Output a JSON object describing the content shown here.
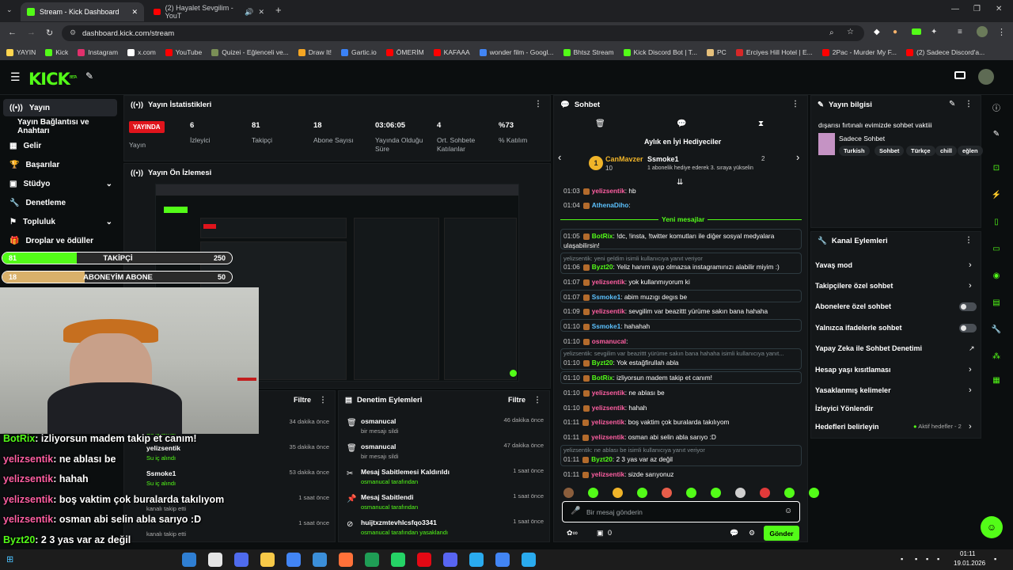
{
  "browser": {
    "tabs": [
      {
        "label": "Stream - Kick Dashboard"
      },
      {
        "label": "(2) Hayalet Sevgilim - YouT"
      }
    ],
    "url": "dashboard.kick.com/stream",
    "bookmarks": [
      "YAYIN",
      "Kick",
      "Instagram",
      "x.com",
      "YouTube",
      "Quizei - Eğlenceli ve...",
      "Draw It!",
      "Gartic.io",
      "ÖMERİM",
      "KAFAAA",
      "wonder film - Googl...",
      "Bhtsz Stream",
      "Kick Discord Bot | T...",
      "PC",
      "Erciyes Hill Hotel | E...",
      "2Pac - Murder My F...",
      "(2) Sadece Discord'a..."
    ]
  },
  "header": {
    "logo": "KICK",
    "beta": "BETA"
  },
  "sidebar": {
    "items": [
      {
        "label": "Yayın"
      },
      {
        "label": "Yayın Bağlantısı ve Anahtarı"
      },
      {
        "label": "Gelir"
      },
      {
        "label": "Başarılar"
      },
      {
        "label": "Stüdyo"
      },
      {
        "label": "Denetleme"
      },
      {
        "label": "Topluluk"
      },
      {
        "label": "Droplar ve ödüller"
      }
    ]
  },
  "stats": {
    "title": "Yayın İstatistikleri",
    "status": "YAYINDA",
    "status_label": "Yayın",
    "items": [
      {
        "value": "6",
        "label": "İzleyici"
      },
      {
        "value": "81",
        "label": "Takipçi"
      },
      {
        "value": "18",
        "label": "Abone Sayısı"
      },
      {
        "value": "03:06:05",
        "label": "Yayında Olduğu Süre"
      },
      {
        "value": "4",
        "label": "Ort. Sohbete Katılanlar"
      },
      {
        "value": "%73",
        "label": "% Katılım"
      }
    ]
  },
  "preview": {
    "title": "Yayın Ön İzlemesi"
  },
  "overlay": {
    "goals": [
      {
        "left": "81",
        "center": "TAKİPÇİ",
        "right": "250",
        "fill": 0.324
      },
      {
        "left": "18",
        "center": "ABONEYİM ABONE",
        "right": "50",
        "fill": 0.36
      }
    ],
    "chat": [
      {
        "user": "BotRix",
        "text": ": izliyorsun madem takip et canım!",
        "color": "#53fc18"
      },
      {
        "user": "yelizsentik",
        "text": ": ne ablası be",
        "color": "#ff5fa2"
      },
      {
        "user": "yelizsentik",
        "text": ": hahah",
        "color": "#ff5fa2"
      },
      {
        "user": "yelizsentik",
        "text": ": boş vaktim çok buralarda takılıyom",
        "color": "#ff5fa2"
      },
      {
        "user": "yelizsentik",
        "text": ": osman abi selin abla sarıyo :D",
        "color": "#ff5fa2"
      },
      {
        "user": "Byzt20",
        "text": ": 2 3 yas var az değil",
        "color": "#53fc18"
      },
      {
        "user": "yelizsentik",
        "text": ": sizde sarıyonuz",
        "color": "#ff5fa2"
      }
    ]
  },
  "activity": {
    "filter": "Filtre",
    "items": [
      {
        "title": "yelizsentik",
        "sub": "Su iç alındı",
        "time": "34 dakika önce"
      },
      {
        "title": "yelizsentik",
        "sub": "Su iç alındı",
        "time": "35 dakika önce"
      },
      {
        "title": "Ssmoke1",
        "sub": "Su iç alındı",
        "time": "53 dakika önce"
      },
      {
        "title": "",
        "sub": "kanalı takip etti",
        "time": "1 saat önce"
      },
      {
        "title": "",
        "sub": "kanalı takip etti",
        "time": "1 saat önce"
      }
    ]
  },
  "moderation": {
    "title": "Denetim Eylemleri",
    "filter": "Filtre",
    "items": [
      {
        "title": "osmanucal",
        "sub": "bir mesajı sildi",
        "time": "46 dakika önce",
        "icon": "trash-icon"
      },
      {
        "title": "osmanucal",
        "sub": "bir mesajı sildi",
        "time": "47 dakika önce",
        "icon": "trash-icon"
      },
      {
        "title": "Mesaj Sabitlemesi Kaldırıldı",
        "sub": "osmanucal tarafından",
        "time": "1 saat önce",
        "icon": "unpin-icon"
      },
      {
        "title": "Mesaj Sabitlendi",
        "sub": "osmanucal tarafından",
        "time": "1 saat önce",
        "icon": "pin-icon"
      },
      {
        "title": "huijtxzmtevhlcsfqo3341",
        "sub": "osmanucal tarafından yasaklandı",
        "time": "1 saat önce",
        "icon": "ban-icon"
      }
    ]
  },
  "chat": {
    "title": "Sohbet",
    "top_gifters": "Aylık en İyi Hediyeciler",
    "gifter1": {
      "name": "CanMavzer",
      "count": "10"
    },
    "gifter2": {
      "name": "Ssmoke1",
      "count": "2",
      "note": "1 abonelik hediye ederek 3. sıraya yükselin"
    },
    "new_messages": "Yeni mesajlar",
    "messages": [
      {
        "time": "01:03",
        "user": "yelizsentik",
        "text": ": hb",
        "color": "#ff5fa2"
      },
      {
        "time": "01:04",
        "user": "AthenaDiho",
        "text": ":",
        "color": "#5cc2ff"
      },
      {
        "time": "01:05",
        "user": "BotRix",
        "text": ": !dc, !insta, !twitter komutları ile diğer sosyal medyalara ulaşabilirsin!",
        "color": "#53fc18"
      },
      {
        "time": "01:06",
        "user": "Byzt20",
        "text": ": Yeliz hanım ayıp olmazsa instagramınızı alabilir miyim :)",
        "color": "#53fc18"
      },
      {
        "time": "01:07",
        "user": "yelizsentik",
        "text": ": yok kullanmıyorum ki",
        "color": "#ff5fa2"
      },
      {
        "time": "01:07",
        "user": "Ssmoke1",
        "text": ": abim muzıgı degıs be",
        "color": "#5cc2ff"
      },
      {
        "time": "01:09",
        "user": "yelizsentik",
        "text": ": sevgilim var beazittt yürüme sakın bana hahaha",
        "color": "#ff5fa2"
      },
      {
        "time": "01:10",
        "user": "Ssmoke1",
        "text": ": hahahah",
        "color": "#5cc2ff"
      },
      {
        "time": "01:10",
        "user": "osmanucal",
        "text": ":",
        "color": "#ff5fa2"
      },
      {
        "time": "01:10",
        "user": "Byzt20",
        "text": ": Yok estağfirullah abla",
        "color": "#53fc18"
      },
      {
        "time": "01:10",
        "user": "BotRix",
        "text": ": izliyorsun madem takip et canım!",
        "color": "#53fc18"
      },
      {
        "time": "01:10",
        "user": "yelizsentik",
        "text": ": ne ablası be",
        "color": "#ff5fa2"
      },
      {
        "time": "01:10",
        "user": "yelizsentik",
        "text": ": hahah",
        "color": "#ff5fa2"
      },
      {
        "time": "01:11",
        "user": "yelizsentik",
        "text": ": boş vaktim çok buralarda takılıyom",
        "color": "#ff5fa2"
      },
      {
        "time": "01:11",
        "user": "yelizsentik",
        "text": ": osman abi selin abla sarıyo :D",
        "color": "#ff5fa2"
      },
      {
        "time": "01:11",
        "user": "Byzt20",
        "text": ": 2 3 yas var az değil",
        "color": "#53fc18"
      },
      {
        "time": "01:11",
        "user": "yelizsentik",
        "text": ": sizde sarıyonuz",
        "color": "#ff5fa2"
      }
    ],
    "replies": [
      "yelizsentik: yeni geldim isimli kullanıcıya yanıt veriyor",
      "yelizsentik: sevgilim var beazittt yürüme sakın bana hahaha isimli kullanıcıya yanıt...",
      "yelizsentik: ne ablası be isimli kullanıcıya yanıt veriyor"
    ],
    "placeholder": "Bir mesaj gönderin",
    "count": "0",
    "send": "Gönder"
  },
  "stream_info": {
    "title": "Yayın bilgisi",
    "stream_title": "dışarısı fırtınalı evimizde sohbet vaktiii",
    "category": "Sadece Sohbet",
    "tags": [
      "Turkish",
      "Sohbet",
      "Türkçe",
      "chill",
      "eğlen"
    ]
  },
  "channel_actions": {
    "title": "Kanal Eylemleri",
    "items": [
      {
        "label": "Yavaş mod",
        "control": "chevron"
      },
      {
        "label": "Takipçilere özel sohbet",
        "control": "chevron"
      },
      {
        "label": "Abonelere özel sohbet",
        "control": "toggle"
      },
      {
        "label": "Yalnızca ifadelerle sohbet",
        "control": "toggle"
      },
      {
        "label": "Yapay Zeka ile Sohbet Denetimi",
        "control": "external"
      },
      {
        "label": "Hesap yaşı kısıtlaması",
        "control": "chevron"
      },
      {
        "label": "Yasaklanmış kelimeler",
        "control": "chevron"
      },
      {
        "label": "İzleyici Yönlendir",
        "control": "none"
      },
      {
        "label": "Hedefleri belirleyin",
        "control": "chevron"
      }
    ],
    "goals_status": "Aktif hedefler - 2"
  },
  "taskbar": {
    "time": "01:11",
    "date": "19.01.2026"
  },
  "colors": {
    "accent": "#53fc18",
    "live": "#e0141c",
    "bg": "#0b0e0f",
    "panel": "#141719"
  }
}
